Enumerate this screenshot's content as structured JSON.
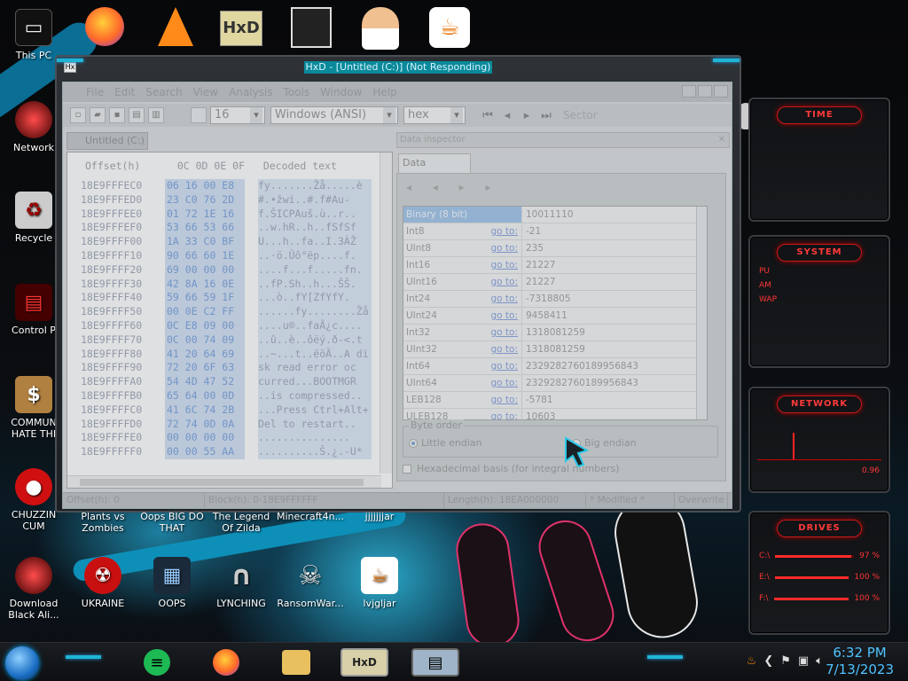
{
  "desktop": {
    "icons": [
      {
        "label": "This PC",
        "glyph": "▭"
      },
      {
        "label": "Network",
        "glyph": "●"
      },
      {
        "label": "Recycle",
        "glyph": "♻"
      },
      {
        "label": "Control P",
        "glyph": "▤"
      },
      {
        "label": "COMMUN HATE THI",
        "glyph": "$"
      },
      {
        "label": "CHUZZIN CUM",
        "glyph": "●"
      },
      {
        "label": "Plants vs Zombies",
        "glyph": ""
      },
      {
        "label": "Oops BIG DO THAT",
        "glyph": ""
      },
      {
        "label": "The Legend Of Zilda",
        "glyph": ""
      },
      {
        "label": "Minecraft4n...",
        "glyph": ""
      },
      {
        "label": "jjjjjjjar",
        "glyph": ""
      },
      {
        "label": "Download Black Ali...",
        "glyph": "●"
      },
      {
        "label": "UKRAINE",
        "glyph": "☢"
      },
      {
        "label": "OOPS",
        "glyph": "▦"
      },
      {
        "label": "LYNCHING",
        "glyph": "∩"
      },
      {
        "label": "RansomWar...",
        "glyph": "☠"
      },
      {
        "label": "lvjgljar",
        "glyph": "☕"
      }
    ],
    "top_icons": [
      "firefox-icon",
      "vlc-icon",
      "hxd-icon",
      "maze-icon",
      "doctor-icon",
      "java-icon"
    ]
  },
  "gadgets": {
    "time": "TIME",
    "system": "SYSTEM",
    "system_rows": [
      "PU",
      "AM",
      "WAP"
    ],
    "network": "NETWORK",
    "network_value": "0.96",
    "drives": "DRIVES",
    "drive_rows": [
      {
        "label": "C:\\",
        "value": "97 %",
        "fill": 0.97
      },
      {
        "label": "E:\\",
        "value": "100 %",
        "fill": 1.0
      },
      {
        "label": "F:\\",
        "value": "100 %",
        "fill": 1.0
      }
    ]
  },
  "window": {
    "title": "HxD - [Untitled (C:)] (Not Responding)",
    "app_icon_text": "Hx",
    "menu": [
      "File",
      "Edit",
      "Search",
      "View",
      "Analysis",
      "Tools",
      "Window",
      "Help"
    ],
    "toolbar": {
      "bytes_per_row": "16",
      "charset": "Windows (ANSI)",
      "offset_base": "hex",
      "sector_label": "Sector"
    },
    "editor_tab": "Untitled (C:)",
    "editor": {
      "header_offset": "Offset(h)",
      "header_cols": "0C 0D 0E 0F",
      "header_decoded": "Decoded text",
      "offsets": [
        "18E9FFFEC0",
        "18E9FFFED0",
        "18E9FFFEE0",
        "18E9FFFEF0",
        "18E9FFFF00",
        "18E9FFFF10",
        "18E9FFFF20",
        "18E9FFFF30",
        "18E9FFFF40",
        "18E9FFFF50",
        "18E9FFFF60",
        "18E9FFFF70",
        "18E9FFFF80",
        "18E9FFFF90",
        "18E9FFFFA0",
        "18E9FFFFB0",
        "18E9FFFFC0",
        "18E9FFFFD0",
        "18E9FFFFE0",
        "18E9FFFFF0"
      ],
      "hex": [
        "06 16 00 E8",
        "23 C0 76 2D",
        "01 72 1E 16",
        "53 66 53 66",
        "1A 33 C0 BF",
        "90 66 60 1E",
        "69 00 00 00",
        "42 8A 16 0E",
        "59 66 59 1F",
        "00 0E C2 FF",
        "0C E8 09 00",
        "0C 00 74 09",
        "41 20 64 69",
        "72 20 6F 63",
        "54 4D 47 52",
        "65 64 00 0D",
        "41 6C 74 2B",
        "72 74 0D 0A",
        "00 00 00 00",
        "00 00 55 AA"
      ],
      "decoded": [
        "fy.......Žå.....è",
        "#.•žwi..#.f#Au-",
        "f.ŠICPAuš.ù..r..",
        "..w.hR..h..fSfSf",
        "U...h..fa..I.3ÀŽ",
        "..·ö.Ûô°ëp....f.",
        "....f...f.....fn.",
        "..fP.Sh..h...ŠŠ.",
        "...ò..fY[ZfYfY.",
        "......fy........Žå",
        "....u®..faÃ¿c....",
        "..û..è..ôëý.ð-<.t",
        "..~...t..ëöÃ..A di",
        "sk read error oc",
        "curred...BOOTMGR",
        "..is compressed..",
        "...Press Ctrl+Alt+",
        "Del to restart..",
        "...............",
        "..........Š.¿.-U*"
      ]
    },
    "inspector_tab_bar": "Data inspector",
    "inspector_tab": "Data inspector",
    "inspector_nav": "◂ ◂ ▸ ▸",
    "inspector_rows": [
      {
        "name": "Binary (8 bit)",
        "goto": "",
        "value": "10011110"
      },
      {
        "name": "Int8",
        "goto": "go to:",
        "value": "-21"
      },
      {
        "name": "UInt8",
        "goto": "go to:",
        "value": "235"
      },
      {
        "name": "Int16",
        "goto": "go to:",
        "value": "21227"
      },
      {
        "name": "UInt16",
        "goto": "go to:",
        "value": "21227"
      },
      {
        "name": "Int24",
        "goto": "go to:",
        "value": "-7318805"
      },
      {
        "name": "UInt24",
        "goto": "go to:",
        "value": "9458411"
      },
      {
        "name": "Int32",
        "goto": "go to:",
        "value": "1318081259"
      },
      {
        "name": "UInt32",
        "goto": "go to:",
        "value": "1318081259"
      },
      {
        "name": "Int64",
        "goto": "go to:",
        "value": "2329282760189956843"
      },
      {
        "name": "UInt64",
        "goto": "go to:",
        "value": "2329282760189956843"
      },
      {
        "name": "LEB128",
        "goto": "go to:",
        "value": "-5781"
      },
      {
        "name": "ULEB128",
        "goto": "go to:",
        "value": "10603"
      }
    ],
    "byte_order_label": "Byte order",
    "little_endian": "Little endian",
    "big_endian": "Big endian",
    "hex_basis": "Hexadecimal basis (for integral numbers)",
    "status": {
      "offset": "Offset(h): 0",
      "block": "Block(h): 0-18E9FFFFFF",
      "length": "Length(h): 18EA000000",
      "modified": "* Modified *",
      "mode": "Overwrite"
    }
  },
  "taskbar": {
    "apps": [
      "notes-icon",
      "firefox-icon",
      "explorer-icon",
      "hxd-icon",
      "monitor-icon"
    ],
    "time": "6:32 PM",
    "date": "7/13/2023"
  }
}
